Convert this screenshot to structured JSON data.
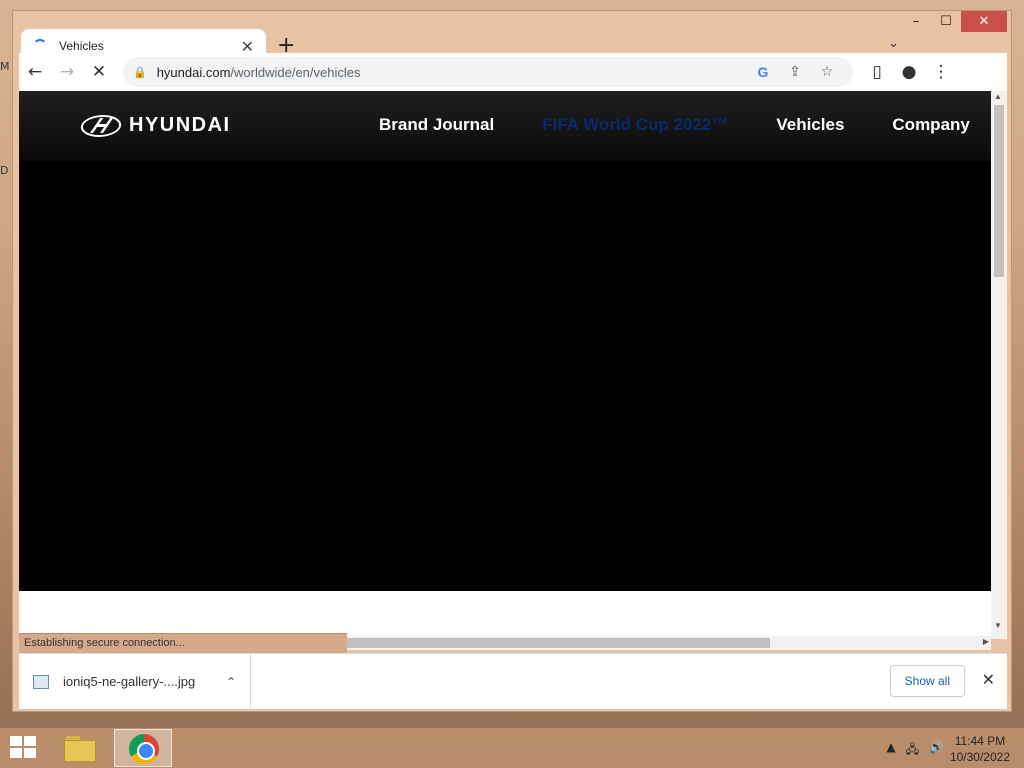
{
  "desktop": {
    "edge_letters": [
      "M",
      "D"
    ]
  },
  "window": {
    "controls": {
      "minimize": "–",
      "maximize": "☐",
      "close": "✕"
    }
  },
  "tabs": [
    {
      "title": "Vehicles",
      "close": "✕"
    }
  ],
  "tabstrip": {
    "new_tab": "+",
    "tab_search": "⌄"
  },
  "toolbar": {
    "back": "←",
    "forward": "→",
    "reload": "✕",
    "url_host": "hyundai.com",
    "url_path": "/worldwide/en/vehicles",
    "google_icon": "G",
    "share_icon": "⇪",
    "bookmark_icon": "☆",
    "side_panel_icon": "▯",
    "profile_icon": "●",
    "menu_icon": "⋮"
  },
  "page": {
    "logo_text": "HYUNDAI",
    "nav": [
      "Brand Journal",
      "FIFA World Cup 2022™",
      "Vehicles",
      "Company"
    ]
  },
  "status": {
    "text": "Establishing secure connection..."
  },
  "scrollbars": {
    "vertical_up": "▲",
    "vertical_down": "▼",
    "horizontal_right": "▶"
  },
  "downloads": {
    "file_name": "ioniq5-ne-gallery-....jpg",
    "chevron": "⌃",
    "show_all": "Show all",
    "close": "✕"
  },
  "taskbar": {
    "tray": [
      "▲",
      "🖧",
      "🔊"
    ],
    "time": "11:44 PM",
    "date": "10/30/2022"
  },
  "colors": {
    "nav_active": "#0b2a6b",
    "close_button": "#c7504a",
    "link": "#1a5fb4"
  }
}
